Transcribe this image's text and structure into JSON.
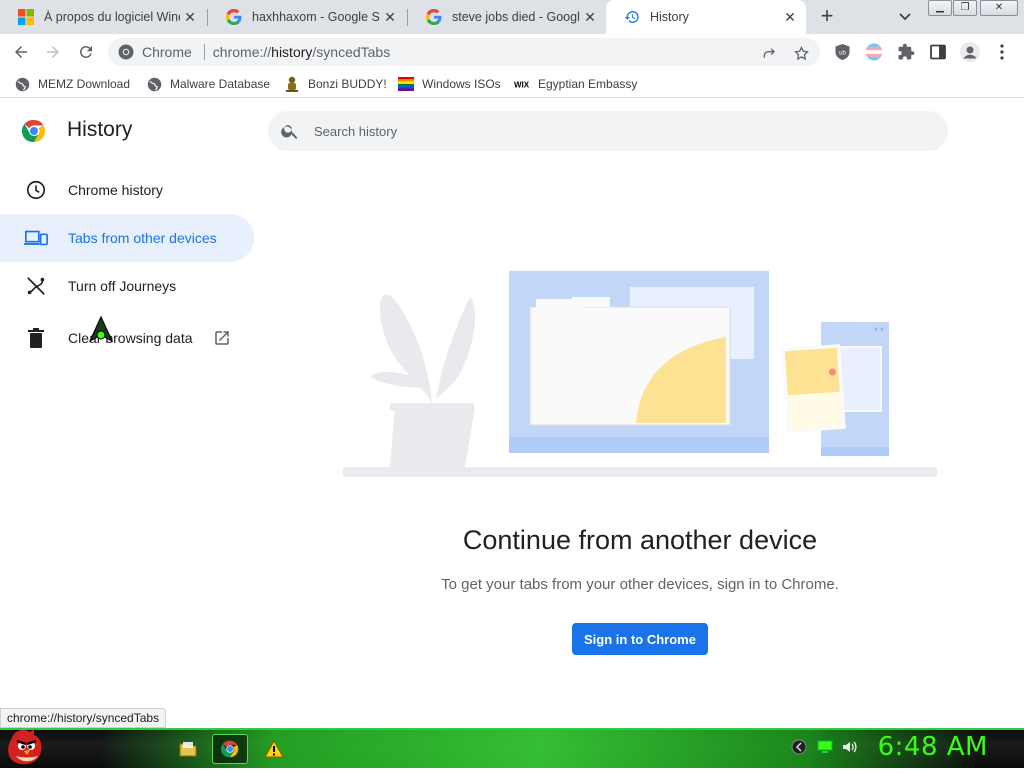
{
  "tabs": [
    {
      "title": "À propos du logiciel Windows",
      "icon": "windows-logo-icon",
      "active": false
    },
    {
      "title": "haxhhaxom - Google Search",
      "icon": "google-g-icon",
      "active": false
    },
    {
      "title": "steve jobs died - Google Search",
      "icon": "google-g-icon",
      "active": false
    },
    {
      "title": "History",
      "icon": "history-icon",
      "active": true
    }
  ],
  "toolbar": {
    "site_chip": "Chrome",
    "url_scheme": "chrome://",
    "url_host": "history",
    "url_path": "/syncedTabs"
  },
  "bookmarks": [
    {
      "label": "MEMZ Download",
      "icon": "globe-icon"
    },
    {
      "label": "Malware Database",
      "icon": "globe-icon"
    },
    {
      "label": "Bonzi BUDDY!",
      "icon": "bonzi-icon"
    },
    {
      "label": "Windows ISOs",
      "icon": "rainbow-flag-icon"
    },
    {
      "label": "Egyptian Embassy",
      "icon": "wix-icon"
    }
  ],
  "sidebar": {
    "title": "History",
    "items": [
      {
        "label": "Chrome history",
        "icon": "clock-icon",
        "selected": false
      },
      {
        "label": "Tabs from other devices",
        "icon": "devices-icon",
        "selected": true
      },
      {
        "label": "Turn off Journeys",
        "icon": "journeys-off-icon",
        "selected": false
      },
      {
        "label": "Clear browsing data",
        "icon": "trash-icon",
        "selected": false
      }
    ]
  },
  "search": {
    "placeholder": "Search history"
  },
  "main": {
    "heading": "Continue from another device",
    "subtext": "To get your tabs from your other devices, sign in to Chrome.",
    "signin_label": "Sign in to Chrome"
  },
  "statusbar": {
    "text": "chrome://history/syncedTabs"
  },
  "taskbar": {
    "clock": "6:48 AM"
  },
  "colors": {
    "accent": "#1a73e8",
    "selected_bg": "#e8f0fe",
    "taskbar_glow": "#39ff14"
  }
}
